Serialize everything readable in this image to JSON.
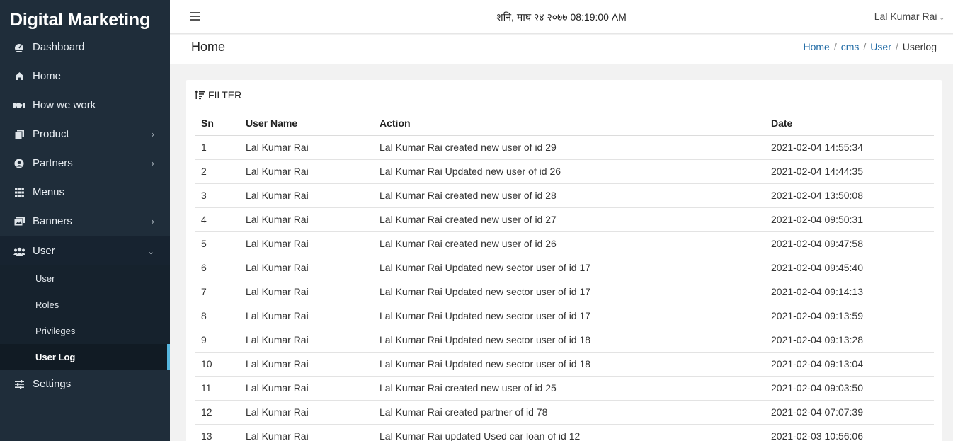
{
  "brand": "Digital Marketing",
  "sidebar": {
    "items": [
      {
        "label": "Dashboard",
        "icon": "dashboard-icon"
      },
      {
        "label": "Home",
        "icon": "home-icon"
      },
      {
        "label": "How we work",
        "icon": "handshake-icon"
      },
      {
        "label": "Product",
        "icon": "copy-icon",
        "has_children": true
      },
      {
        "label": "Partners",
        "icon": "user-circle-icon",
        "has_children": true
      },
      {
        "label": "Menus",
        "icon": "grid-icon"
      },
      {
        "label": "Banners",
        "icon": "images-icon",
        "has_children": true
      },
      {
        "label": "User",
        "icon": "users-icon",
        "expanded": true
      },
      {
        "label": "Settings",
        "icon": "sliders-icon"
      }
    ],
    "user_submenu": [
      "User",
      "Roles",
      "Privileges",
      "User Log"
    ],
    "active_submenu": "User Log"
  },
  "topbar": {
    "datetime": "शनि, माघ २४ २०७७ 08:19:00 AM",
    "user_name": "Lal Kumar Rai"
  },
  "page": {
    "title": "Home",
    "breadcrumb": [
      "Home",
      "cms",
      "User",
      "Userlog"
    ]
  },
  "filter_label": "FILTER",
  "table": {
    "headers": [
      "Sn",
      "User Name",
      "Action",
      "Date"
    ],
    "rows": [
      [
        "1",
        "Lal Kumar Rai",
        "Lal Kumar Rai created new user of id 29",
        "2021-02-04 14:55:34"
      ],
      [
        "2",
        "Lal Kumar Rai",
        "Lal Kumar Rai Updated new user of id 26",
        "2021-02-04 14:44:35"
      ],
      [
        "3",
        "Lal Kumar Rai",
        "Lal Kumar Rai created new user of id 28",
        "2021-02-04 13:50:08"
      ],
      [
        "4",
        "Lal Kumar Rai",
        "Lal Kumar Rai created new user of id 27",
        "2021-02-04 09:50:31"
      ],
      [
        "5",
        "Lal Kumar Rai",
        "Lal Kumar Rai created new user of id 26",
        "2021-02-04 09:47:58"
      ],
      [
        "6",
        "Lal Kumar Rai",
        "Lal Kumar Rai Updated new sector user of id 17",
        "2021-02-04 09:45:40"
      ],
      [
        "7",
        "Lal Kumar Rai",
        "Lal Kumar Rai Updated new sector user of id 17",
        "2021-02-04 09:14:13"
      ],
      [
        "8",
        "Lal Kumar Rai",
        "Lal Kumar Rai Updated new sector user of id 17",
        "2021-02-04 09:13:59"
      ],
      [
        "9",
        "Lal Kumar Rai",
        "Lal Kumar Rai Updated new sector user of id 18",
        "2021-02-04 09:13:28"
      ],
      [
        "10",
        "Lal Kumar Rai",
        "Lal Kumar Rai Updated new sector user of id 18",
        "2021-02-04 09:13:04"
      ],
      [
        "11",
        "Lal Kumar Rai",
        "Lal Kumar Rai created new user of id 25",
        "2021-02-04 09:03:50"
      ],
      [
        "12",
        "Lal Kumar Rai",
        "Lal Kumar Rai created partner of id 78",
        "2021-02-04 07:07:39"
      ],
      [
        "13",
        "Lal Kumar Rai",
        "Lal Kumar Rai updated Used car loan of id 12",
        "2021-02-03 10:56:06"
      ]
    ]
  },
  "colors": {
    "sidebar_bg": "#1f2d3a",
    "active_indicator": "#56b6de",
    "link": "#1f6aa5"
  }
}
